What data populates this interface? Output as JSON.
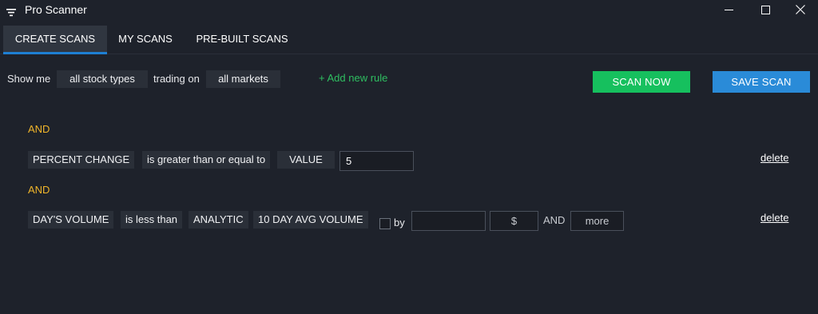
{
  "window": {
    "title": "Pro Scanner",
    "controls": {
      "minimize_icon": "minimize-icon",
      "maximize_icon": "maximize-icon",
      "close_icon": "close-icon"
    }
  },
  "tabs": [
    {
      "label": "CREATE SCANS",
      "active": true
    },
    {
      "label": "MY SCANS",
      "active": false
    },
    {
      "label": "PRE-BUILT SCANS",
      "active": false
    }
  ],
  "filter": {
    "show_me": "Show me",
    "stock_types": "all stock types",
    "trading_on": "trading on",
    "markets": "all markets",
    "add_rule": "+ Add new rule"
  },
  "actions": {
    "scan_now": "SCAN NOW",
    "save_scan": "SAVE SCAN"
  },
  "rules": [
    {
      "connector": "AND",
      "field": "PERCENT CHANGE",
      "operator": "is greater than or equal to",
      "compare_type": "VALUE",
      "value": "5",
      "delete": "delete"
    },
    {
      "connector": "AND",
      "field": "DAY'S VOLUME",
      "operator": "is less than",
      "compare_type": "ANALYTIC",
      "analytic": "10 DAY AVG VOLUME",
      "by_label": "by",
      "by_value": "",
      "unit": "$",
      "and_label": "AND",
      "more": "more",
      "delete": "delete"
    }
  ],
  "colors": {
    "background": "#1e222b",
    "accent_tab": "#1e7fd3",
    "scan_now": "#16c05e",
    "save_scan": "#2a8bd8",
    "and_connector": "#f0b52a",
    "add_rule": "#2fbf61"
  }
}
